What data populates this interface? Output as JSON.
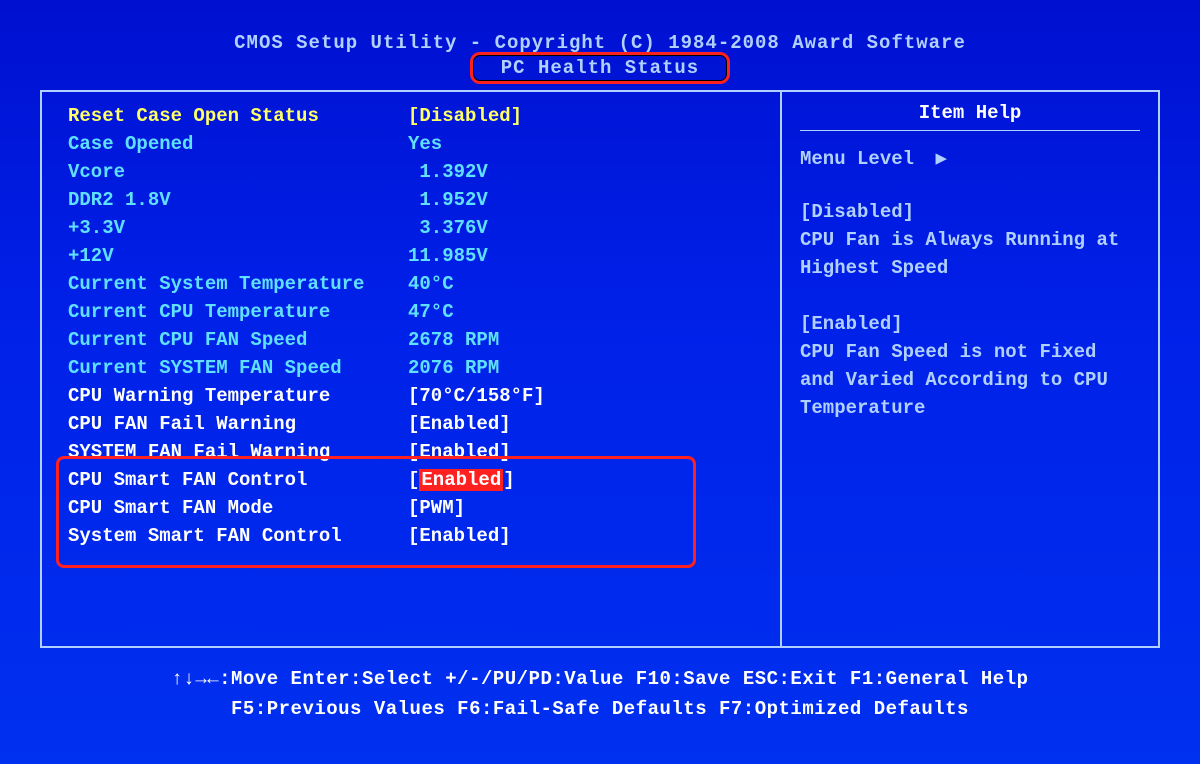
{
  "header": {
    "title": "CMOS Setup Utility - Copyright (C) 1984-2008 Award Software",
    "subtitle": "PC Health Status"
  },
  "settings": [
    {
      "label": "Reset Case Open Status",
      "value": "[Disabled]",
      "labelClass": "yellow",
      "valueClass": "yellow",
      "interact": true
    },
    {
      "label": "Case Opened",
      "value": "Yes",
      "labelClass": "cyan",
      "valueClass": "cyan",
      "interact": false
    },
    {
      "label": "Vcore",
      "value": " 1.392V",
      "labelClass": "cyan",
      "valueClass": "cyan",
      "interact": false
    },
    {
      "label": "DDR2 1.8V",
      "value": " 1.952V",
      "labelClass": "cyan",
      "valueClass": "cyan",
      "interact": false
    },
    {
      "label": "+3.3V",
      "value": " 3.376V",
      "labelClass": "cyan",
      "valueClass": "cyan",
      "interact": false
    },
    {
      "label": "+12V",
      "value": "11.985V",
      "labelClass": "cyan",
      "valueClass": "cyan",
      "interact": false
    },
    {
      "label": "Current System Temperature",
      "value": "40°C",
      "labelClass": "cyan",
      "valueClass": "cyan",
      "interact": false
    },
    {
      "label": "Current CPU Temperature",
      "value": "47°C",
      "labelClass": "cyan",
      "valueClass": "cyan",
      "interact": false
    },
    {
      "label": "Current CPU FAN Speed",
      "value": "2678 RPM",
      "labelClass": "cyan",
      "valueClass": "cyan",
      "interact": false
    },
    {
      "label": "Current SYSTEM FAN Speed",
      "value": "2076 RPM",
      "labelClass": "cyan",
      "valueClass": "cyan",
      "interact": false
    },
    {
      "label": "CPU Warning Temperature",
      "value": "[70°C/158°F]",
      "labelClass": "",
      "valueClass": "",
      "interact": true
    },
    {
      "label": "CPU FAN Fail Warning",
      "value": "[Enabled]",
      "labelClass": "",
      "valueClass": "",
      "interact": true
    },
    {
      "label": "SYSTEM FAN Fail Warning",
      "value": "[Enabled]",
      "labelClass": "",
      "valueClass": "",
      "interact": true
    },
    {
      "label": "CPU Smart FAN Control",
      "value_pre": "[",
      "value_sel": "Enabled",
      "value_post": "]",
      "labelClass": "",
      "valueClass": "",
      "interact": true,
      "selected": true
    },
    {
      "label": "CPU Smart FAN Mode",
      "value": "[PWM]",
      "labelClass": "",
      "valueClass": "",
      "interact": true
    },
    {
      "label": "System Smart FAN Control",
      "value": "[Enabled]",
      "labelClass": "",
      "valueClass": "",
      "interact": true
    }
  ],
  "help": {
    "title": "Item Help",
    "menu_level": "Menu Level",
    "triangle": "▶",
    "blocks": [
      {
        "heading": "[Disabled]",
        "body": "CPU Fan is Always Running at Highest Speed"
      },
      {
        "heading": "[Enabled]",
        "body": "CPU Fan Speed is not Fixed and Varied According to CPU Temperature"
      }
    ]
  },
  "footer": {
    "line1": "↑↓→←:Move   Enter:Select   +/-/PU/PD:Value   F10:Save   ESC:Exit   F1:General Help",
    "line2": "F5:Previous Values   F6:Fail-Safe Defaults   F7:Optimized Defaults"
  }
}
